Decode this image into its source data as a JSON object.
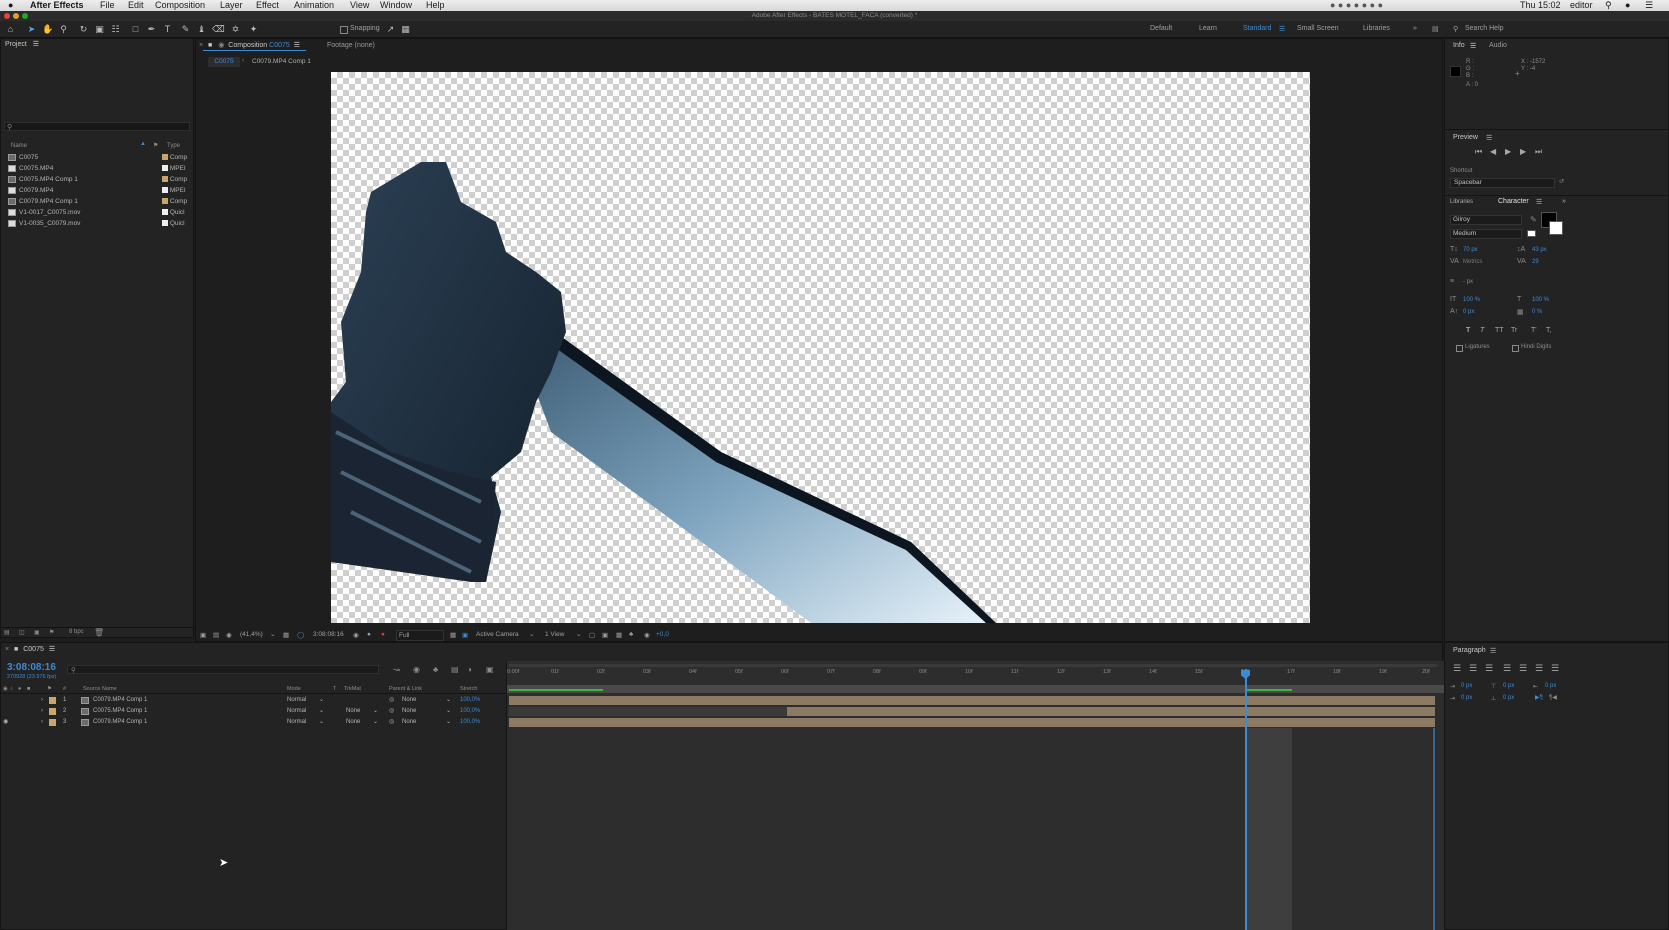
{
  "menubar": {
    "apple": "",
    "app_name": "After Effects",
    "items": [
      "File",
      "Edit",
      "Composition",
      "Layer",
      "Effect",
      "Animation",
      "View",
      "Window",
      "Help"
    ],
    "clock": "Thu 15:02",
    "user": "editor"
  },
  "window_title": "Adobe After Effects - BATES MOTEL_FACA (converted) *",
  "toolbar": {
    "snapping_label": "Snapping",
    "workspaces": [
      "Default",
      "Learn",
      "Standard",
      "Small Screen",
      "Libraries"
    ],
    "active_workspace": "Standard",
    "search_placeholder": "Search Help"
  },
  "project": {
    "title": "Project",
    "col_name": "Name",
    "col_type": "Type",
    "items": [
      {
        "name": "C0075",
        "type": "Comp"
      },
      {
        "name": "C0075.MP4",
        "type": "MPEI"
      },
      {
        "name": "C0075.MP4 Comp 1",
        "type": "Comp"
      },
      {
        "name": "C0079.MP4",
        "type": "MPEI"
      },
      {
        "name": "C0079.MP4 Comp 1",
        "type": "Comp"
      },
      {
        "name": "V1-0017_C0075.mov",
        "type": "Quicl"
      },
      {
        "name": "V1-0035_C0079.mov",
        "type": "Quicl"
      }
    ],
    "bpc": "8 bpc"
  },
  "composition": {
    "tab_prefix": "Composition",
    "tab_name": "C0075",
    "footage_tab": "Footage (none)",
    "breadcrumb_1": "C0075",
    "breadcrumb_2": "C0079.MP4 Comp 1",
    "zoom": "(41,4%)",
    "timecode": "3:08:08:16",
    "resolution": "Full",
    "camera": "Active Camera",
    "views": "1 View",
    "exposure": "+0,0"
  },
  "info": {
    "tab_info": "Info",
    "tab_audio": "Audio",
    "r": "R :",
    "g": "G :",
    "b": "B :",
    "a": "A : 0",
    "x": "X : -1572",
    "y": "Y : -4"
  },
  "preview": {
    "title": "Preview",
    "shortcut_label": "Shortcut",
    "shortcut_value": "Spacebar"
  },
  "character": {
    "tab_libraries": "Libraries",
    "tab_character": "Character",
    "font": "Gilroy",
    "style": "Medium",
    "size": "70 px",
    "leading": "43 px",
    "kerning": "Metrics",
    "tracking": "29",
    "stroke": "- px",
    "vscale": "100 %",
    "hscale": "100 %",
    "baseline": "0 px",
    "tsume": "0 %",
    "style_buttons": [
      "T",
      "T",
      "TT",
      "Tr",
      "T'",
      "T,"
    ],
    "ligatures": "Ligatures",
    "hindi": "Hindi Digits"
  },
  "paragraph": {
    "title": "Paragraph",
    "indent_values": [
      "0 px",
      "0 px",
      "0 px",
      "0 px",
      "0 px"
    ]
  },
  "timeline": {
    "tab_name": "C0075",
    "timecode": "3:08:08:16",
    "fps": "270928 (23.976 fps)",
    "columns": {
      "source_name": "Source Name",
      "mode": "Mode",
      "t": "T",
      "trkmat": "TrkMat",
      "parent": "Parent & Link",
      "stretch": "Stretch"
    },
    "layers": [
      {
        "num": "1",
        "name": "C0079.MP4 Comp 1",
        "mode": "Normal",
        "trkmat": "",
        "parent": "None",
        "stretch": "100,0%"
      },
      {
        "num": "2",
        "name": "C0075.MP4 Comp 1",
        "mode": "Normal",
        "trkmat": "None",
        "parent": "None",
        "stretch": "100,0%"
      },
      {
        "num": "3",
        "name": "C0079.MP4 Comp 1",
        "mode": "Normal",
        "trkmat": "None",
        "parent": "None",
        "stretch": "100,0%"
      }
    ],
    "ruler": [
      "0:00f",
      "01f",
      "02f",
      "03f",
      "04f",
      "05f",
      "06f",
      "07f",
      "08f",
      "09f",
      "10f",
      "11f",
      "12f",
      "13f",
      "14f",
      "15f",
      "16f",
      "17f",
      "18f",
      "19f",
      "20f"
    ]
  },
  "colors": {
    "accent": "#3d8bd6",
    "layer_bar": "#8d7a64",
    "panel_bg": "#232323",
    "label_tan": "#c9a56a"
  }
}
